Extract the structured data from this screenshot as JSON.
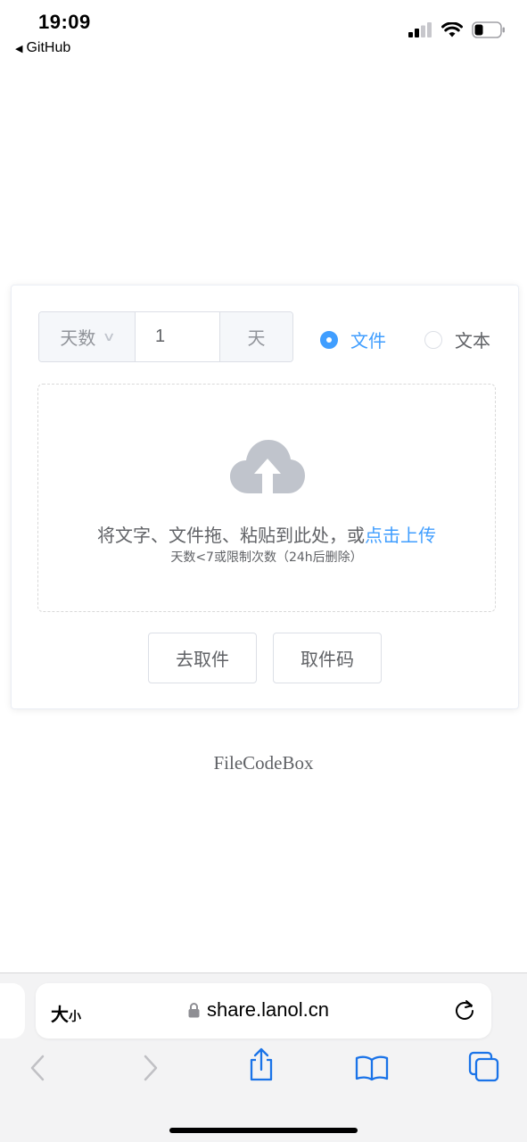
{
  "status_bar": {
    "time": "19:09",
    "back_label": "GitHub",
    "icons": [
      "cellular-signal-icon",
      "wifi-icon",
      "battery-icon"
    ]
  },
  "form": {
    "expire_type": "天数",
    "expire_value": "1",
    "expire_unit": "天",
    "radio_options": [
      {
        "label": "文件",
        "checked": true
      },
      {
        "label": "文本",
        "checked": false
      }
    ]
  },
  "upload": {
    "icon": "cloud-upload-icon",
    "text_main": "将文字、文件拖、粘贴到此处，或",
    "text_link": "点击上传",
    "tip": "天数<7或限制次数（24h后删除）"
  },
  "buttons": {
    "get_file": "去取件",
    "pickup_code": "取件码"
  },
  "footer": {
    "brand": "FileCodeBox"
  },
  "browser": {
    "text_size_big": "大",
    "text_size_small": "小",
    "url": "share.lanol.cn"
  },
  "colors": {
    "accent": "#409eff",
    "text": "#606266",
    "muted": "#909399",
    "border": "#dcdfe6",
    "icon_gray": "#c0c4cc"
  }
}
